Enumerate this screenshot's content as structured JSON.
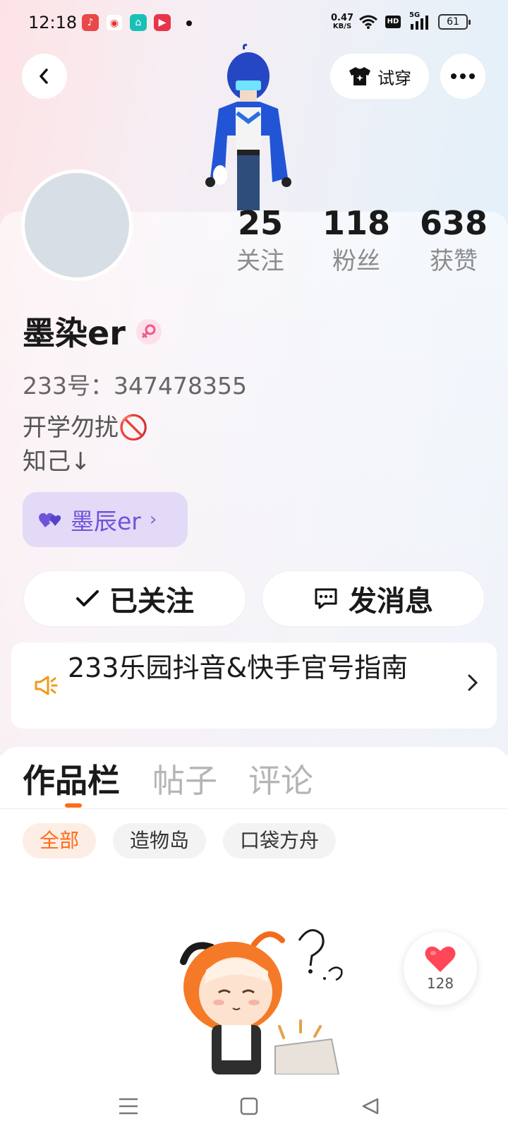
{
  "status_bar": {
    "time": "12:18",
    "net_speed_value": "0.47",
    "net_speed_unit": "KB/S",
    "hd_label": "HD",
    "signal_label": "5G",
    "battery": "61"
  },
  "header": {
    "try_on_label": "试穿"
  },
  "stats": [
    {
      "value": "25",
      "label": "关注"
    },
    {
      "value": "118",
      "label": "粉丝"
    },
    {
      "value": "638",
      "label": "获赞"
    }
  ],
  "profile": {
    "name": "墨染er",
    "uid": "233号：347478355",
    "bio": "开学勿扰🚫\n知己↓",
    "group_chip": "墨辰er"
  },
  "actions": {
    "follow_label": "已关注",
    "message_label": "发消息"
  },
  "notice": {
    "text": "233乐园抖音&快手官号指南"
  },
  "tabs": [
    "作品栏",
    "帖子",
    "评论"
  ],
  "filters": [
    "全部",
    "造物岛",
    "口袋方舟"
  ],
  "like_count": "128",
  "colors": {
    "accent": "#ff6a1a",
    "chip_purple": "#6e55d8",
    "like_red": "#ff4757"
  }
}
